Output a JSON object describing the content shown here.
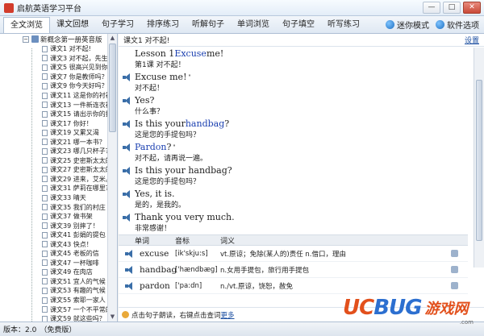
{
  "window": {
    "title": "启航英语学习平台",
    "buttons": [
      "—",
      "□",
      "✕"
    ]
  },
  "tabs": [
    {
      "label": "全文浏览",
      "active": true
    },
    {
      "label": "课文回想",
      "active": false
    },
    {
      "label": "句子学习",
      "active": false
    },
    {
      "label": "排序练习",
      "active": false
    },
    {
      "label": "听解句子",
      "active": false
    },
    {
      "label": "单词浏览",
      "active": false
    },
    {
      "label": "句子填空",
      "active": false
    },
    {
      "label": "听写练习",
      "active": false
    }
  ],
  "toolbar": {
    "mini_mode": "迷你模式",
    "software_options": "软件选项"
  },
  "sidebar": {
    "root": "新概念第一册英音版",
    "items": [
      "课文1 对不起!",
      "课文3 对不起，先生。",
      "课文5 很高兴见到你。",
      "课文7 你是教师吗？",
      "课文9 你今天好吗？",
      "课文11 这是你的衬衫",
      "课文13 一件新连衣裙",
      "课文15 请出示你的护照",
      "课文17 你好！",
      "课文19 又累又渴",
      "课文21 哪一本书？",
      "课文23 哪几只杯子？",
      "课文25 史密斯太太的",
      "课文27 史密斯太太的",
      "课文29 进来，艾米。",
      "课文31 萨莉在哪里？",
      "课文33 晴天",
      "课文35 我们的村庄",
      "课文37 做书架",
      "课文39 别摔了！",
      "课文41 彭娟的提包",
      "课文43 快点！",
      "课文45 老板的信",
      "课文47 一杯咖啡",
      "课文49 在肉店",
      "课文51 宜人的气候",
      "课文53 有趣的气候",
      "课文55 索耶一家人",
      "课文57 一个不平常的",
      "课文59 就这些吗？",
      "课文61 坏感冒"
    ]
  },
  "content": {
    "header": "课文1 对不起!",
    "settings": "设置",
    "lesson_title_en_prefix": "Lesson 1 ",
    "lesson_title_en_kw": "Excuse",
    "lesson_title_en_suffix": " me!",
    "lesson_title_cn": "第1课 对不起！",
    "lines": [
      {
        "en": "Excuse me!",
        "kw": "",
        "sup": "\"",
        "cn": "对不起！"
      },
      {
        "en": "Yes?",
        "kw": "",
        "sup": "",
        "cn": "什么事？"
      },
      {
        "en_prefix": "Is this your ",
        "kw": "handbag",
        "en_suffix": "?",
        "cn": "这是您的手提包吗？"
      },
      {
        "en_prefix": "",
        "kw": "Pardon",
        "en_suffix": "?",
        "sup": "\"",
        "cn": "对不起，请再说一遍。"
      },
      {
        "en": "Is this your handbag?",
        "cn": "这是您的手提包吗？"
      },
      {
        "en": "Yes, it is.",
        "cn": "是的，是我的。"
      },
      {
        "en": "Thank you very much.",
        "cn": "非常感谢！"
      }
    ]
  },
  "vocab": {
    "headers": {
      "word": "单词",
      "phonetic": "音标",
      "meaning": "词义"
    },
    "rows": [
      {
        "word": "excuse",
        "phonetic": "[ik'skju:s]",
        "meaning": "vt.原谅；免除(某人的)责任 n.借口，理由"
      },
      {
        "word": "handbag",
        "phonetic": "['hændbæg]",
        "meaning": "n.女用手提包，旅行用手提包"
      },
      {
        "word": "pardon",
        "phonetic": "['pa:dn]",
        "meaning": "n./vt.原谅，饶恕，赦免"
      }
    ]
  },
  "hint": {
    "text": "点击句子朗读，右键点击查词",
    "link": "更多"
  },
  "status": {
    "version": "版本：2.0",
    "edition": "（免费版）"
  },
  "watermark": {
    "uc": "UC",
    "bug": "BUG",
    "cn": "游戏网",
    "url": ".com"
  }
}
